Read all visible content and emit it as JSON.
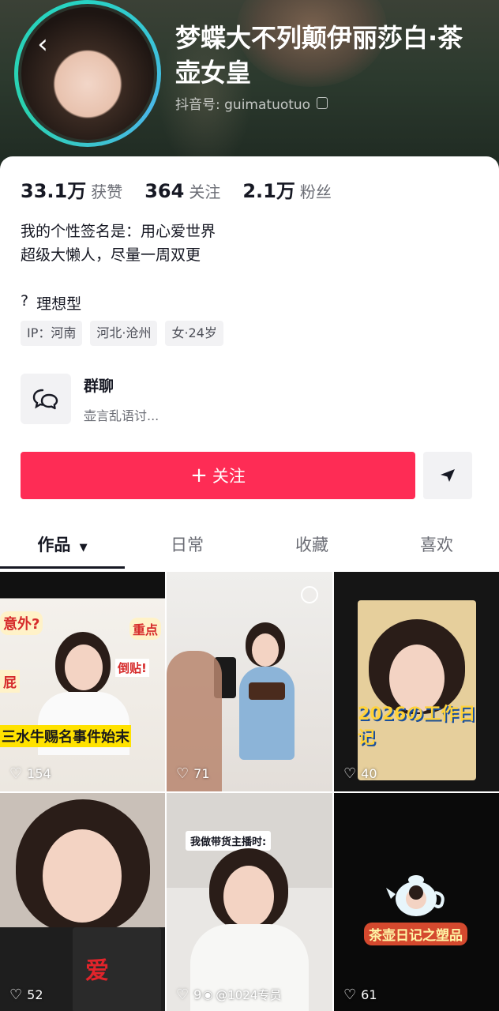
{
  "profile": {
    "nickname": "梦蝶大不列颠伊丽莎白·茶壶女皇",
    "douyin_id": "抖音号: guimatuotuo"
  },
  "stats": [
    {
      "value": "33.1万",
      "label": "获赞"
    },
    {
      "value": "364",
      "label": "关注"
    },
    {
      "value": "2.1万",
      "label": "粉丝"
    }
  ],
  "bio": {
    "line1": "我的个性签名是：用心爱世界",
    "line2": "超级大懒人，尽量一周双更"
  },
  "ideal": {
    "icon": "?",
    "text": "理想型"
  },
  "tags": [
    "IP：河南",
    "河北·沧州",
    "女·24岁"
  ],
  "group_chat": {
    "title": "群聊",
    "subtitle": "壶言乱语讨..."
  },
  "actions": {
    "follow_label": "关注"
  },
  "tabs": [
    {
      "label": "作品",
      "active": true
    },
    {
      "label": "日常",
      "active": false
    },
    {
      "label": "收藏",
      "active": false
    },
    {
      "label": "喜欢",
      "active": false
    }
  ],
  "videos": [
    {
      "likes": "154",
      "caption": "三水牛赐名事件始末",
      "labels": [
        "意外?",
        "重点",
        "倒贴!",
        "屁"
      ]
    },
    {
      "likes": "71"
    },
    {
      "likes": "40",
      "caption": "2026の工作日记"
    },
    {
      "likes": "52",
      "caption": "爱"
    },
    {
      "likes": "9",
      "caption": "我做带货主播时:",
      "watermark": "@1024专员"
    },
    {
      "likes": "61",
      "caption": "茶壶日记之塑品"
    }
  ],
  "colors": {
    "accent": "#fe2c55",
    "text": "#161823",
    "subtext": "#6b6d75",
    "tag_bg": "#f2f2f4"
  }
}
